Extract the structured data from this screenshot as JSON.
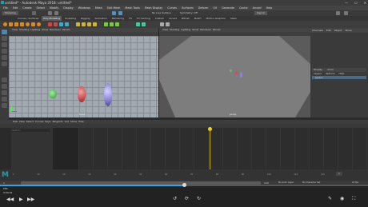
{
  "app": {
    "title": "untitled* - Autodesk Maya 2018: untitled*",
    "window_buttons": [
      "—",
      "☐",
      "✕"
    ]
  },
  "menubar": [
    "File",
    "Edit",
    "Create",
    "Select",
    "Modify",
    "Display",
    "Windows",
    "Mesh",
    "Edit Mesh",
    "Mesh Tools",
    "Mesh Display",
    "Curves",
    "Surfaces",
    "Deform",
    "UV",
    "Generate",
    "Cache",
    "Arnold",
    "Help"
  ],
  "status_line": {
    "mode": "Modeling",
    "no_live_surface": "No Live Surface",
    "symmetry": "Symmetry: Off",
    "sign_in": "Sign In"
  },
  "shelf_tabs": [
    "Curves / Surfaces",
    "Poly Modeling",
    "Sculpting",
    "Rigging",
    "Animation",
    "Rendering",
    "FX",
    "FX Caching",
    "Custom",
    "Arnold",
    "Bifrost",
    "MASH",
    "Motion Graphics",
    "XGen"
  ],
  "shelf_active": "Poly Modeling",
  "viewport_left": {
    "menu": [
      "View",
      "Shading",
      "Lighting",
      "Show",
      "Renderer",
      "Panels"
    ],
    "label": "front"
  },
  "viewport_right": {
    "menu": [
      "View",
      "Shading",
      "Lighting",
      "Show",
      "Renderer",
      "Panels"
    ],
    "label": "persp"
  },
  "right_panel": {
    "tabs": [
      "Channels",
      "Edit",
      "Object",
      "Show"
    ],
    "layer_tabs": [
      "Display",
      "Anim"
    ],
    "layer_menu": [
      "Layers",
      "Options",
      "Help"
    ],
    "layer_item": "layer1"
  },
  "graph_editor": {
    "menu": [
      "Edit",
      "View",
      "Select",
      "Curves",
      "Keys",
      "Tangents",
      "List",
      "Show",
      "Help"
    ],
    "search_placeholder": "Search..."
  },
  "timeslider": {
    "ticks": [
      "1",
      "5",
      "10",
      "15",
      "20",
      "25",
      "30",
      "35",
      "40",
      "45",
      "50",
      "55",
      "60",
      "65",
      "70",
      "75",
      "80",
      "85",
      "90",
      "95",
      "100",
      "105",
      "110",
      "115",
      "120"
    ],
    "current_frame": "1",
    "start": "1",
    "end": "120",
    "range_end": "200",
    "anim_layer": "No Anim Layer",
    "char_set": "No Character Set",
    "fps": "24 fps"
  },
  "command_line": {
    "mel": "MEL"
  },
  "video_player": {
    "progress": 0.5,
    "time_label": "0:00:01",
    "accent": "#3aa0e0"
  },
  "colors": {
    "sphere_green": "#5cc35c",
    "capsule_red": "#d25050",
    "capsule_purple": "#8c84d8",
    "playhead": "#f0d21e"
  }
}
